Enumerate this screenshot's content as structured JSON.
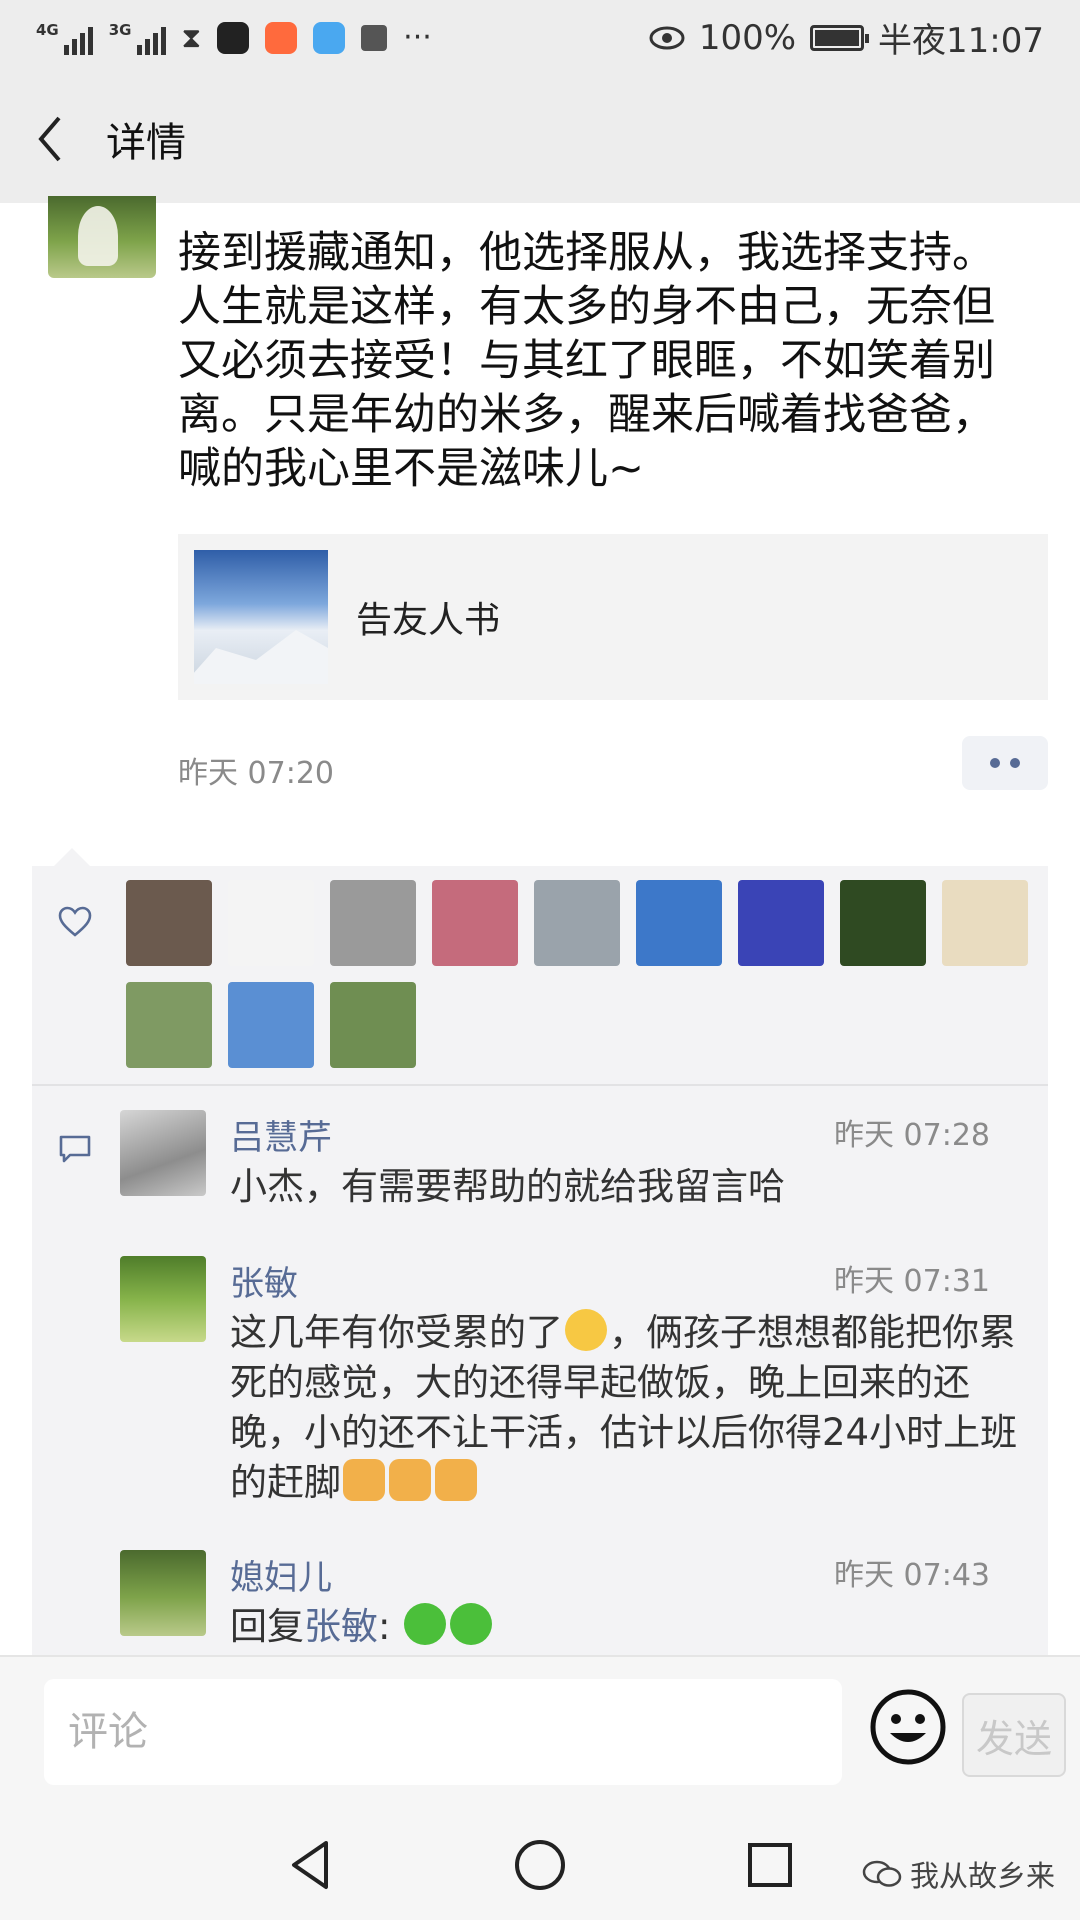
{
  "status_bar": {
    "network_1": "4G",
    "network_2": "3G",
    "battery": "100%",
    "time": "半夜11:07"
  },
  "nav": {
    "title": "详情"
  },
  "post": {
    "text": "接到援藏通知，他选择服从，我选择支持。人生就是这样，有太多的身不由己，无奈但又必须去接受！与其红了眼眶，不如笑着别离。只是年幼的米多，醒来后喊着找爸爸，喊的我心里不是滋味儿~",
    "link_title": "告友人书",
    "time": "昨天 07:20"
  },
  "likes": {
    "avatars": [
      {
        "name": "family-photo",
        "color": "#6b5a4e"
      },
      {
        "name": "calligraphy-text",
        "color": "#f4f4f4"
      },
      {
        "name": "kitten",
        "color": "#9a9a9a"
      },
      {
        "name": "sunset-pier",
        "color": "#c56b7c"
      },
      {
        "name": "lake-sunset",
        "color": "#9aa3ab"
      },
      {
        "name": "blue-sky-hills",
        "color": "#3d78c9"
      },
      {
        "name": "red-fish-blue",
        "color": "#3a44b6"
      },
      {
        "name": "narcissus-flower",
        "color": "#2f4a22"
      },
      {
        "name": "gold-logo",
        "color": "#e9dcc0"
      },
      {
        "name": "field-road",
        "color": "#7f9a63"
      },
      {
        "name": "sky-trees",
        "color": "#5a8fd3"
      },
      {
        "name": "green-field",
        "color": "#6f8e52"
      }
    ]
  },
  "comments": [
    {
      "name": "吕慧芹",
      "time": "昨天 07:28",
      "text": "小杰，有需要帮助的就给我留言哈"
    },
    {
      "name": "张敏",
      "time": "昨天 07:31",
      "text": "这几年有你受累的了",
      "text_rest": "，俩孩子想想都能把你累死的感觉，大的还得早起做饭，晚上回来的还晚，小的还不让干活，估计以后你得24小时上班的赶脚"
    },
    {
      "name": "媳妇儿",
      "time": "昨天 07:43",
      "reply_prefix": "回复",
      "reply_to": "张敏",
      "reply_suffix": ":"
    }
  ],
  "input": {
    "placeholder": "评论",
    "send_label": "发送"
  },
  "watermark": "我从故乡来",
  "colors": {
    "link_blue": "#576b95",
    "bar_gray": "#ededed"
  }
}
